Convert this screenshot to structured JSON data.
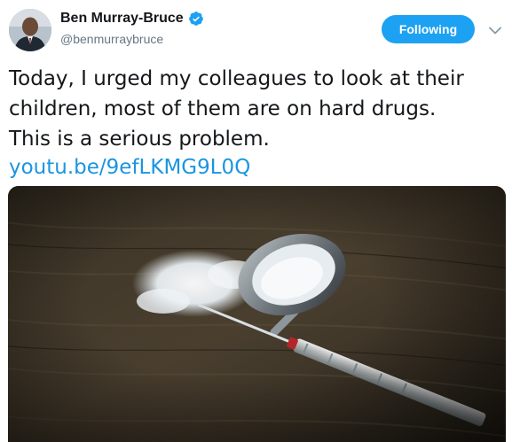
{
  "user": {
    "display_name": "Ben Murray-Bruce",
    "handle": "@benmurraybruce",
    "verified": true,
    "avatar_icon": "profile-photo"
  },
  "follow_button": {
    "label": "Following"
  },
  "menu": {
    "icon": "chevron-down-icon"
  },
  "tweet": {
    "lines": [
      "Today, I urged my colleagues to look at their",
      "children, most of them are on hard drugs.",
      "This is a serious problem."
    ],
    "link": "youtu.be/9efLKMG9L0Q"
  },
  "media": {
    "description_icon": "spoon-powder-syringe-photo"
  },
  "colors": {
    "accent": "#1da1f2",
    "link": "#1b95e0",
    "text": "#14171a",
    "muted": "#657786"
  }
}
